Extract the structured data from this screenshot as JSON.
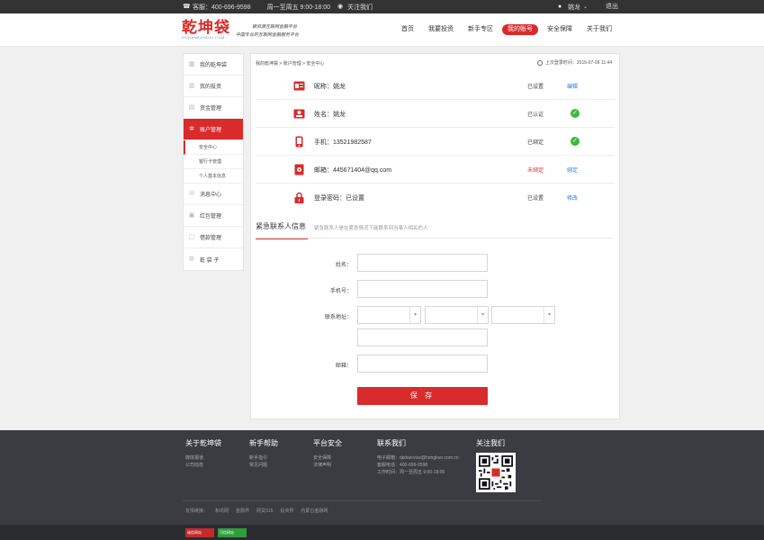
{
  "topbar": {
    "hotline": "客服：400-696-9598",
    "hours": "周一至周五 9:00-18:00",
    "follow": "关注我们",
    "username": "姚龙",
    "logout": "退出"
  },
  "header": {
    "logo_text": "乾坤袋",
    "logo_sub": "51QIANKUNDAI.COM",
    "slogan_1": "银资源互联网金融平台",
    "slogan_2": "中国专业的互联网金融服务平台",
    "nav": [
      {
        "label": "首页",
        "active": false
      },
      {
        "label": "我要投资",
        "active": false
      },
      {
        "label": "新手专区",
        "active": false
      },
      {
        "label": "我的账号",
        "active": true
      },
      {
        "label": "安全保障",
        "active": false
      },
      {
        "label": "关于我们",
        "active": false
      }
    ]
  },
  "sidebar": {
    "items": [
      {
        "label": "我的乾坤袋",
        "icon": "home-icon"
      },
      {
        "label": "我的投资",
        "icon": "chart-icon"
      },
      {
        "label": "资金管理",
        "icon": "wallet-icon"
      },
      {
        "label": "账户管理",
        "icon": "gear-icon"
      },
      {
        "label": "消息中心",
        "icon": "message-icon"
      },
      {
        "label": "红包管理",
        "icon": "redpacket-icon"
      },
      {
        "label": "借款管理",
        "icon": "loan-icon"
      },
      {
        "label": "乾 袋 子",
        "icon": "bag-icon"
      }
    ],
    "subitems": [
      "安全中心",
      "银行卡管理",
      "个人基本信息"
    ]
  },
  "main": {
    "breadcrumb": "我的乾坤袋 > 账户管理 > 安全中心",
    "last_login": "上次登录时间：2015-07-09 11:44",
    "rows": [
      {
        "label": "昵称：姚龙",
        "status": "已设置",
        "action": "编辑",
        "icon": "id-card-icon",
        "kind": "link"
      },
      {
        "label": "姓名：姚龙",
        "status": "已认证",
        "action": "",
        "icon": "name-card-icon",
        "kind": "check"
      },
      {
        "label": "手机：13521982587",
        "status": "已绑定",
        "action": "",
        "icon": "phone-icon",
        "kind": "check"
      },
      {
        "label": "邮箱：445671404@qq.com",
        "status": "未绑定",
        "action": "绑定",
        "icon": "mail-icon",
        "kind": "link"
      },
      {
        "label": "登录密码：已设置",
        "status": "已设置",
        "action": "修改",
        "icon": "lock-icon",
        "kind": "link"
      }
    ],
    "emergency": {
      "title": "紧急联系人信息",
      "hint": "紧急联系人是在紧急情况下能联系到当事人相关的人",
      "name_label": "姓名：",
      "phone_label": "手机号：",
      "address_label": "联系地址：",
      "email_label": "邮箱：",
      "save_label": "保 存"
    }
  },
  "footer": {
    "cols": [
      {
        "title": "关于乾坤袋",
        "links": [
          "媒体报道",
          "公司动态"
        ]
      },
      {
        "title": "新手帮助",
        "links": [
          "新手指引",
          "常见问题"
        ]
      },
      {
        "title": "平台安全",
        "links": [
          "安全保障",
          "法律声明"
        ]
      },
      {
        "title": "联系我们",
        "links": [
          "电子邮箱：qkdservice@hongkun.com.cn",
          "客服电话：400-696-9598",
          "工作时间：周一至周五 9:00-18:00"
        ]
      },
      {
        "title": "关注我们",
        "links": []
      }
    ],
    "friend_label": "友情链接：",
    "friend_links": [
      "和讯网",
      "金融界",
      "网贷315",
      "投资界",
      "内蒙古金融网"
    ],
    "badges": [
      "诚信网站",
      "可信网站"
    ]
  },
  "colors": {
    "brand": "#d92b2b",
    "link": "#2a7dd8",
    "ok": "#3dba3d",
    "footer_bg": "#3a3c42"
  }
}
